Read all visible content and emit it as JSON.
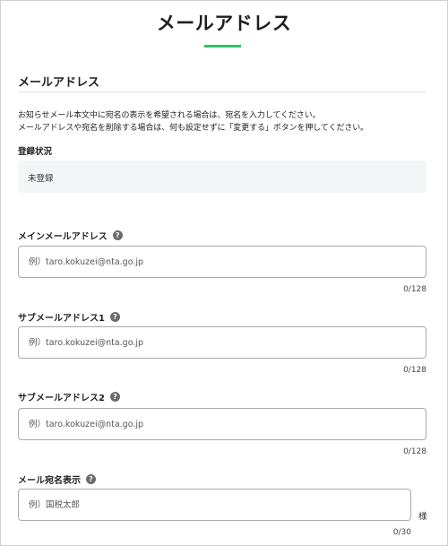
{
  "page": {
    "title": "メールアドレス"
  },
  "section": {
    "heading": "メールアドレス",
    "description_lines": [
      "お知らせメール本文中に宛名の表示を希望される場合は、宛名を入力してください。",
      "メールアドレスや宛名を削除する場合は、何も設定せずに「変更する」ボタンを押してください。"
    ]
  },
  "status": {
    "label": "登録状況",
    "value": "未登録"
  },
  "fields": {
    "main_email": {
      "label": "メインメールアドレス",
      "placeholder": "例）taro.kokuzei@nta.go.jp",
      "value": "",
      "counter": "0/128"
    },
    "sub_email_1": {
      "label": "サブメールアドレス1",
      "placeholder": "例）taro.kokuzei@nta.go.jp",
      "value": "",
      "counter": "0/128"
    },
    "sub_email_2": {
      "label": "サブメールアドレス2",
      "placeholder": "例）taro.kokuzei@nta.go.jp",
      "value": "",
      "counter": "0/128"
    },
    "mail_name": {
      "label": "メール宛名表示",
      "placeholder": "例）国税太郎",
      "value": "",
      "suffix": "様",
      "counter": "0/30"
    }
  },
  "icons": {
    "help": "?"
  },
  "colors": {
    "accent": "#2fc36a",
    "status_background": "#f3f6f7",
    "input_border": "#aaaaaa",
    "help_icon": "#6b6b6b"
  }
}
